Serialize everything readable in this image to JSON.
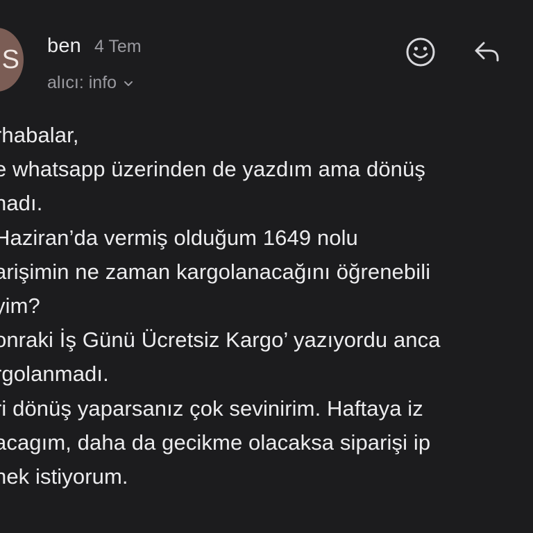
{
  "header": {
    "avatar_letter": "S",
    "sender_name": "ben",
    "date": "4 Tem",
    "recipient": "alıcı: info",
    "emoji_icon": "smiley-icon",
    "reply_icon": "reply-arrow-icon"
  },
  "message": {
    "lines": [
      "rhabalar,",
      "e whatsapp üzerinden de yazdım ama dönüş",
      "nadı.",
      " Haziran’da vermiş olduğum 1649 nolu",
      "arişimin ne zaman kargolanacağını öğrenebili",
      "yim?",
      "onraki İş Günü Ücretsiz Kargo’ yazıyordu anca",
      "rgolanmadı.",
      "ri dönüş yaparsanız çok sevinirim. Haftaya iz",
      "acagım, daha da gecikme olacaksa siparişi ip",
      "nek istiyorum."
    ]
  },
  "colors": {
    "background": "#1c1c1e",
    "text": "#ececee",
    "secondary_text": "#9a9aa0",
    "avatar": "#7b5d55"
  }
}
